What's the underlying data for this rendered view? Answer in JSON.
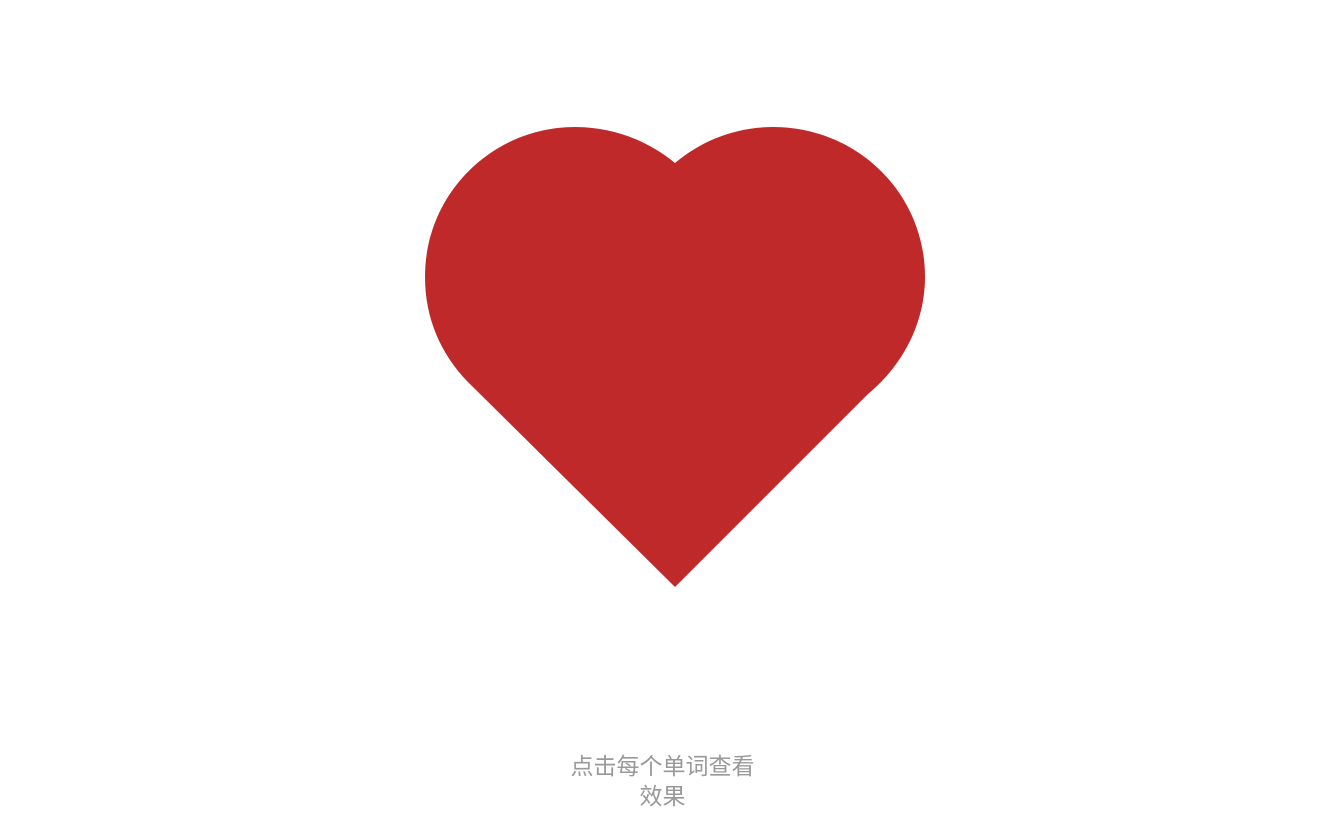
{
  "heart": {
    "icon": "heart-icon",
    "color": "#c0292a"
  },
  "hint": {
    "line1": "点击每个单词查看",
    "line2": "效果"
  }
}
